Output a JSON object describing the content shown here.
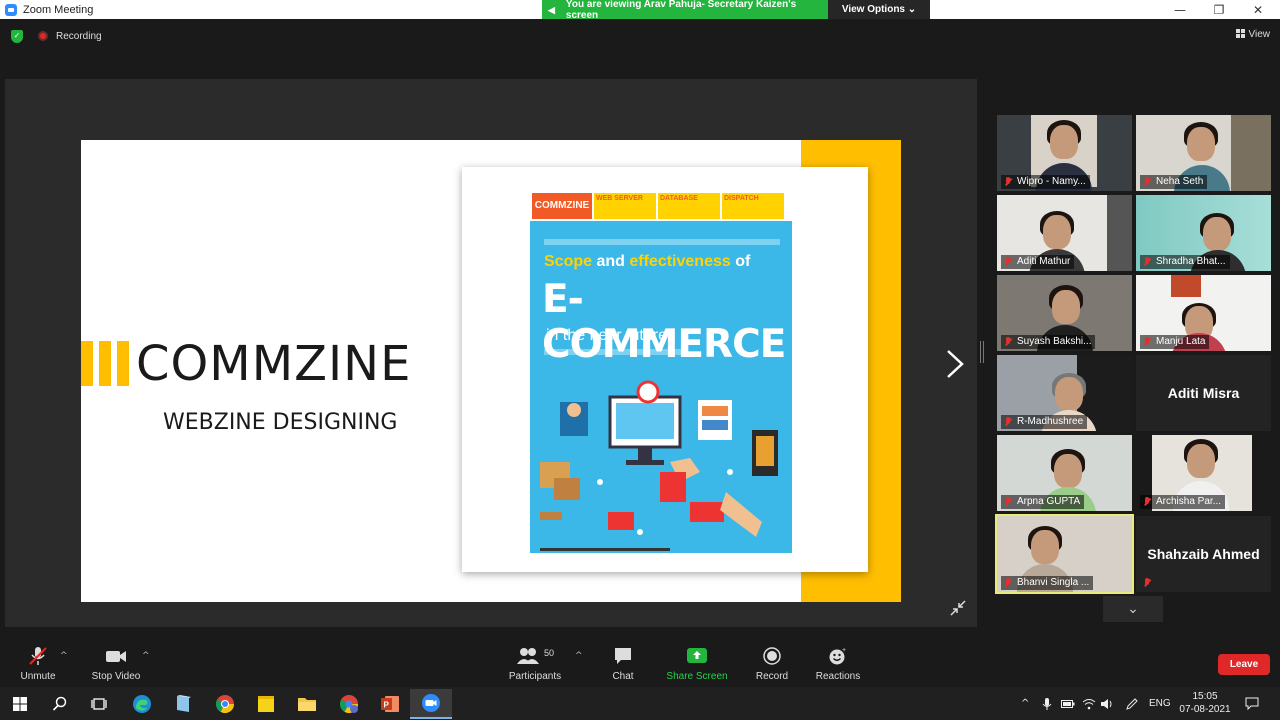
{
  "window": {
    "title": "Zoom Meeting",
    "minimize_icon": "—",
    "restore_icon": "❐",
    "close_icon": "✕"
  },
  "share_banner": {
    "text": "You are viewing Arav Pahuja- Secretary Kaizen's screen",
    "view_options": "View Options ⌄"
  },
  "status": {
    "recording_label": "Recording",
    "view_label": "View"
  },
  "slide": {
    "brand": "COMMZINE",
    "tagline": "WEBZINE DESIGNING",
    "accent_color": "#ffbe00"
  },
  "magazine": {
    "logo": "COMMZINE",
    "sections": [
      "WEB SERVER",
      "DATABASE",
      "DISPATCH"
    ],
    "headline_1a": "Scope",
    "headline_1b": "and",
    "headline_1c": "effectiveness",
    "headline_1d": "of",
    "headline_2": "E-COMMERCE",
    "headline_3": "in the near future"
  },
  "participants": [
    {
      "name": "Wipro - Namy...",
      "muted": true
    },
    {
      "name": "Neha Seth",
      "muted": true
    },
    {
      "name": "Aditi Mathur",
      "muted": true
    },
    {
      "name": "Shradha Bhat...",
      "muted": true
    },
    {
      "name": "Suyash Bakshi...",
      "muted": true
    },
    {
      "name": "Manju Lata",
      "muted": true
    },
    {
      "name": "R-Madhushree",
      "muted": true
    },
    {
      "name": "Aditi Misra",
      "muted": false
    },
    {
      "name": "Arpna GUPTA",
      "muted": true
    },
    {
      "name": "Archisha Par...",
      "muted": true
    },
    {
      "name": "Bhanvi Singla ...",
      "muted": true
    },
    {
      "name": "Shahzaib Ahmed",
      "muted": true
    }
  ],
  "toolbar": {
    "unmute": "Unmute",
    "stop_video": "Stop Video",
    "participants": "Participants",
    "participant_count": "50",
    "chat": "Chat",
    "share_screen": "Share Screen",
    "record": "Record",
    "reactions": "Reactions",
    "leave": "Leave"
  },
  "taskbar": {
    "language": "ENG",
    "time": "15:05",
    "date": "07-08-2021"
  }
}
